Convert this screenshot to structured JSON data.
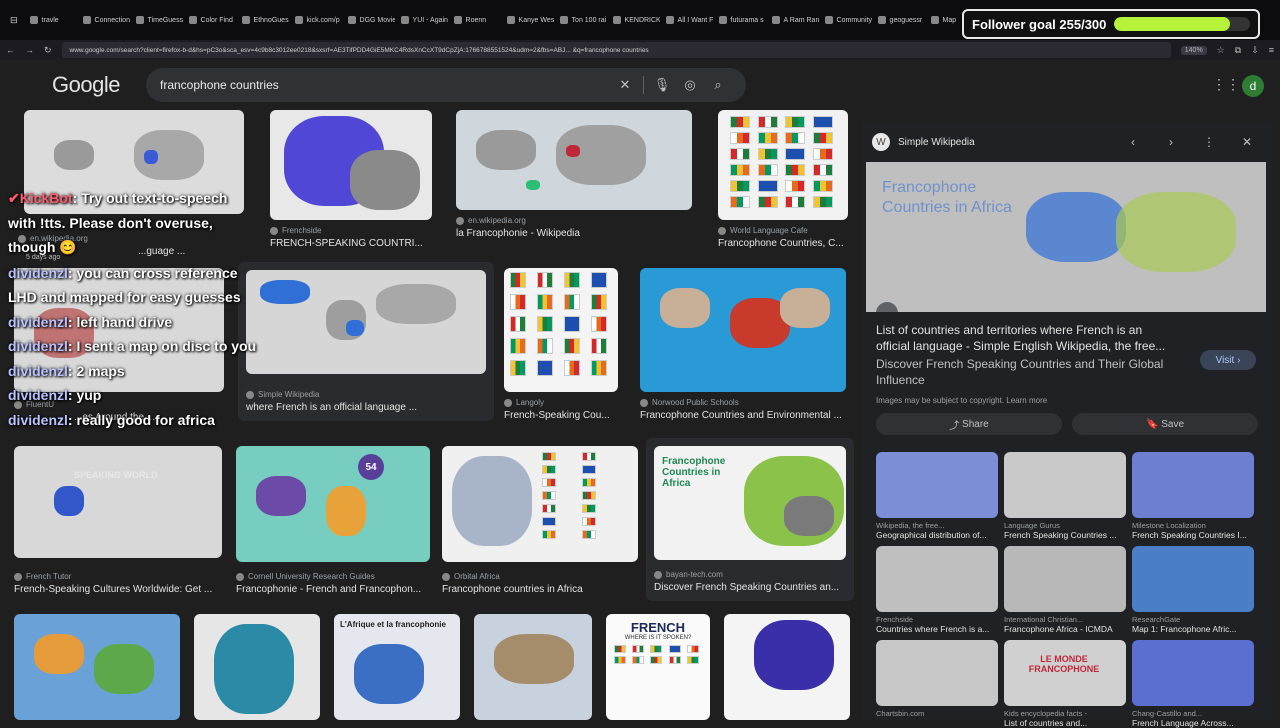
{
  "browser": {
    "tabs": [
      {
        "label": "travle"
      },
      {
        "label": "Connection"
      },
      {
        "label": "TimeGuessr"
      },
      {
        "label": "Color Find"
      },
      {
        "label": "EthnoGuess"
      },
      {
        "label": "kick.com/p"
      },
      {
        "label": "DGG Movie"
      },
      {
        "label": "YUI - Again"
      },
      {
        "label": "Roenn"
      },
      {
        "label": "Kanye West"
      },
      {
        "label": "Ton 100 rai"
      },
      {
        "label": "KENDRICK"
      },
      {
        "label": "All I Want F"
      },
      {
        "label": "futurama s"
      },
      {
        "label": "A Ram Ranch C"
      },
      {
        "label": "Community"
      },
      {
        "label": "geoguessr"
      },
      {
        "label": "Map"
      }
    ],
    "url": "www.google.com/search?client=firefox-b-d&hs=pC3o&sca_esv=4c9b8c3012ee0218&sxsrf=AE3TifPDD4GiE5MKC4RdsXnCcXT9dCpZjA:1766788551524&udm=2&fbs=ABJ... &q=francophone countries",
    "zoom": "140%"
  },
  "overlay": {
    "goal_text": "Follower goal 255/300",
    "goal_fraction": 0.85
  },
  "google": {
    "logo": "Google",
    "query": "francophone countries",
    "avatar_letter": "d"
  },
  "results": [
    {
      "source": "",
      "title": ""
    },
    {
      "source": "Frenchside",
      "title": "FRENCH-SPEAKING COUNTRI..."
    },
    {
      "source": "en.wikipedia.org",
      "title": "la Francophonie - Wikipedia"
    },
    {
      "source": "World Language Cafe",
      "title": "Francophone Countries, C..."
    },
    {
      "source": "en.wikipedia.org",
      "title": "...guage ..."
    },
    {
      "source": "Simple Wikipedia",
      "title": "where French is an official language ..."
    },
    {
      "source": "Langoly",
      "title": "French-Speaking Cou..."
    },
    {
      "source": "Norwood Public Schools",
      "title": "Francophone Countries and Environmental ..."
    },
    {
      "source": "FluentU",
      "title": "...es Around the ..."
    },
    {
      "source": "French Tutor",
      "title": "French-Speaking Cultures Worldwide: Get ..."
    },
    {
      "source": "Cornell University Research Guides",
      "title": "Francophonie - French and Francophon..."
    },
    {
      "source": "Orbital Africa",
      "title": "Francophone countries in Africa"
    },
    {
      "source": "bayan-tech.com",
      "title": "Discover French Speaking Countries an..."
    },
    {
      "source": "",
      "title": ""
    },
    {
      "source": "",
      "title": ""
    },
    {
      "source": "",
      "title": ""
    },
    {
      "source": "",
      "title": ""
    },
    {
      "source": "",
      "title": ""
    },
    {
      "source": "",
      "title": ""
    }
  ],
  "thumb_text": {
    "africa_map_title": "Francophone Countries in Africa",
    "count_badge": "54",
    "french_poster": "FRENCH",
    "french_poster_sub": "WHERE IS IT SPOKEN?",
    "afrique": "L'Afrique et la francophonie",
    "speaking_world": "SPEAKING WORLD"
  },
  "panel": {
    "site": "Simple Wikipedia",
    "image_text": "Francophone Countries in Africa",
    "title": "List of countries and territories where French is an official language - Simple English Wikipedia, the free...",
    "title2": "Discover French Speaking Countries and Their Global Influence",
    "visit": "Visit",
    "note": "Images may be subject to copyright. Learn more",
    "share": "Share",
    "save": "Save",
    "related": [
      {
        "source": "Wikipedia, the free...",
        "title": "Geographical distribution of..."
      },
      {
        "source": "Language Gurus",
        "title": "French Speaking Countries ..."
      },
      {
        "source": "Milestone Localization",
        "title": "French Speaking Countries I..."
      },
      {
        "source": "Frenchside",
        "title": "Countries where French is a..."
      },
      {
        "source": "International Christian...",
        "title": "Francophone Africa - ICMDA"
      },
      {
        "source": "ResearchGate",
        "title": "Map 1: Francophone Afric..."
      },
      {
        "source": "Chartsbin.com",
        "title": ""
      },
      {
        "source": "Kids encyclopedia facts -",
        "title": "List of countries and..."
      },
      {
        "source": "Chang-Castillo and...",
        "title": "French Language Across..."
      }
    ],
    "related_badge": "LE MONDE FRANCOPHONE"
  },
  "chat": [
    {
      "user": "✔KickBot",
      "text": ": Try out text-to-speech with !tts. Please don't overuse, though 😊",
      "bot": true,
      "note": "5 days ago"
    },
    {
      "user": "dividenzl",
      "text": ": you can cross reference LHD and mapped for easy guesses"
    },
    {
      "user": "dividenzl",
      "text": ": left hand drive"
    },
    {
      "user": "dividenzl",
      "text": ": I sent a map on disc to you"
    },
    {
      "user": "dividenzl",
      "text": ": 2 maps"
    },
    {
      "user": "dividenzl",
      "text": ": yup"
    },
    {
      "user": "dividenzl",
      "text": ": really good for africa"
    }
  ]
}
